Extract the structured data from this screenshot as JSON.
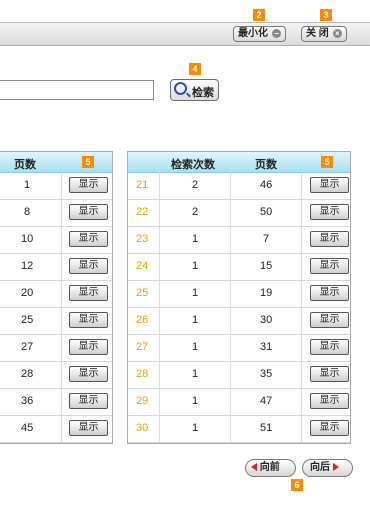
{
  "titlebar": {
    "minimize_label": "最小化",
    "close_label": "关 闭",
    "minimize_badge": "2",
    "close_badge": "3"
  },
  "search": {
    "value": "",
    "button_label": "检索",
    "badge": "4"
  },
  "left_table": {
    "headers": [
      "页数",
      "5"
    ],
    "rows": [
      {
        "pages": "1",
        "action": "显示"
      },
      {
        "pages": "8",
        "action": "显示"
      },
      {
        "pages": "10",
        "action": "显示"
      },
      {
        "pages": "12",
        "action": "显示"
      },
      {
        "pages": "20",
        "action": "显示"
      },
      {
        "pages": "25",
        "action": "显示"
      },
      {
        "pages": "27",
        "action": "显示"
      },
      {
        "pages": "28",
        "action": "显示"
      },
      {
        "pages": "36",
        "action": "显示"
      },
      {
        "pages": "45",
        "action": "显示"
      }
    ]
  },
  "right_table": {
    "headers": [
      "检索次数",
      "页数",
      "5"
    ],
    "rows": [
      {
        "index": "21",
        "count": "2",
        "pages": "46",
        "action": "显示"
      },
      {
        "index": "22",
        "count": "2",
        "pages": "50",
        "action": "显示"
      },
      {
        "index": "23",
        "count": "1",
        "pages": "7",
        "action": "显示"
      },
      {
        "index": "24",
        "count": "1",
        "pages": "15",
        "action": "显示"
      },
      {
        "index": "25",
        "count": "1",
        "pages": "19",
        "action": "显示"
      },
      {
        "index": "26",
        "count": "1",
        "pages": "30",
        "action": "显示"
      },
      {
        "index": "27",
        "count": "1",
        "pages": "31",
        "action": "显示"
      },
      {
        "index": "28",
        "count": "1",
        "pages": "35",
        "action": "显示"
      },
      {
        "index": "29",
        "count": "1",
        "pages": "47",
        "action": "显示"
      },
      {
        "index": "30",
        "count": "1",
        "pages": "51",
        "action": "显示"
      }
    ]
  },
  "pager": {
    "prev_label": "向前",
    "next_label": "向后",
    "badge": "6"
  },
  "colors": {
    "badge": "#ff8a00",
    "index_text": "#e8a200",
    "header_bg": "#a8dff0",
    "arrow": "#e02020"
  }
}
